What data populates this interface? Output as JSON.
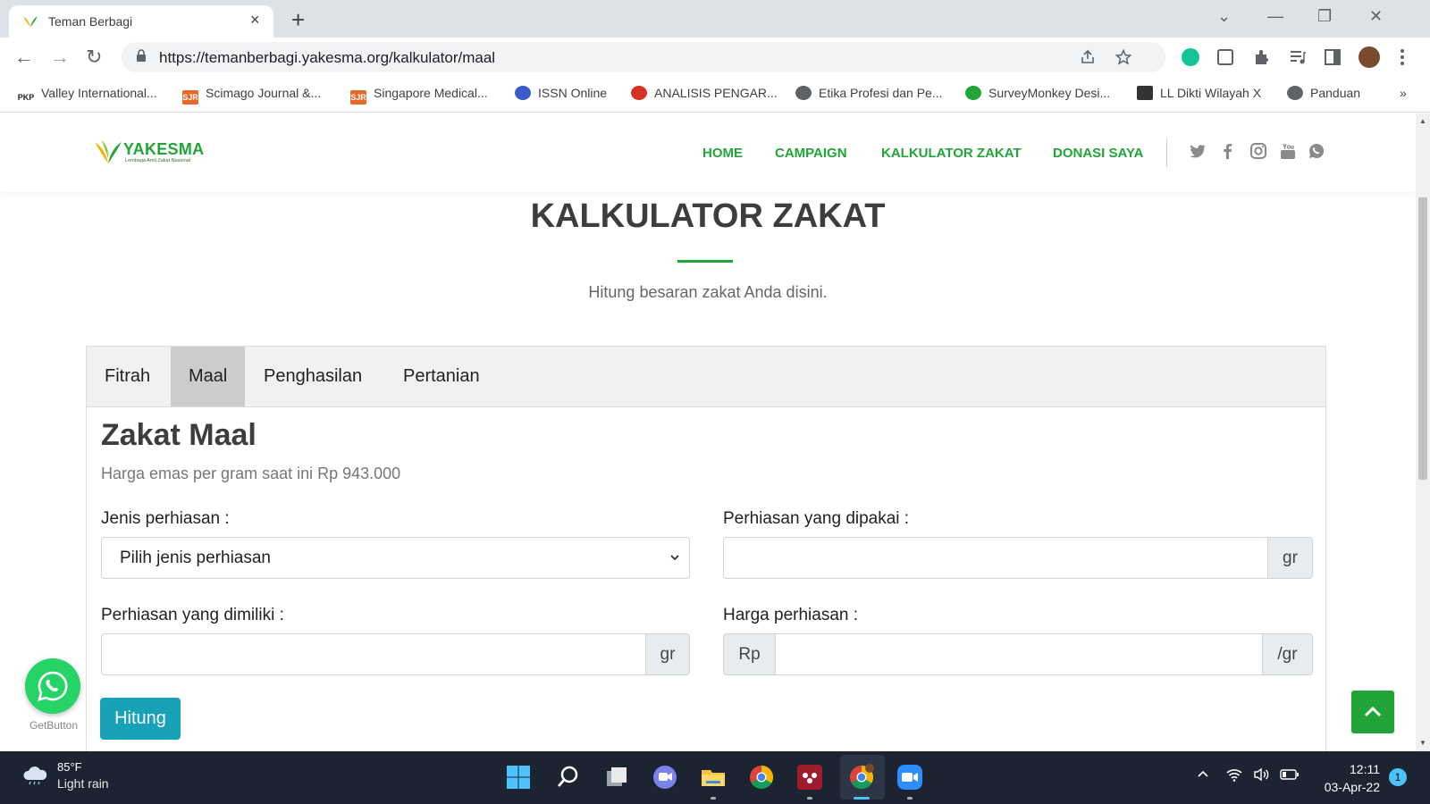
{
  "browser": {
    "tab_title": "Teman Berbagi",
    "tab_close": "×",
    "new_tab": "+",
    "url": "https://temanberbagi.yakesma.org/kalkulator/maal",
    "window_controls": {
      "dropdown": "⌄",
      "minimize": "—",
      "restore": "❐",
      "close": "✕"
    },
    "nav": {
      "back": "←",
      "forward": "→",
      "reload": "↻"
    },
    "bookmarks": [
      {
        "label": "Valley International...",
        "badge": "PKP",
        "color": "#ffffff"
      },
      {
        "label": "Scimago Journal &...",
        "badge": "SJR",
        "color": "#e8682a"
      },
      {
        "label": "Singapore Medical...",
        "badge": "SJR",
        "color": "#e8682a"
      },
      {
        "label": "ISSN Online",
        "badge": "",
        "color": "#3b5bcc"
      },
      {
        "label": "ANALISIS PENGAR...",
        "badge": "",
        "color": "#d93025"
      },
      {
        "label": "Etika Profesi dan Pe...",
        "badge": "",
        "color": "#5f6368"
      },
      {
        "label": "SurveyMonkey Desi...",
        "badge": "",
        "color": "#21a438"
      },
      {
        "label": "LL Dikti Wilayah X",
        "badge": "",
        "color": "#333333"
      },
      {
        "label": "Panduan",
        "badge": "",
        "color": "#5f6368"
      }
    ],
    "more_bookmarks": "»"
  },
  "site": {
    "logo_text": "YAKESMA",
    "logo_subtitle": "Lembaga Amil Zakat Nasional",
    "nav": [
      "HOME",
      "CAMPAIGN",
      "KALKULATOR ZAKAT",
      "DONASI SAYA"
    ],
    "social_icons": [
      "twitter-icon",
      "facebook-icon",
      "instagram-icon",
      "youtube-icon",
      "whatsapp-icon"
    ],
    "accent_color": "#21a438"
  },
  "page": {
    "title": "KALKULATOR ZAKAT",
    "subtitle": "Hitung besaran zakat Anda disini.",
    "tabs": [
      "Fitrah",
      "Maal",
      "Penghasilan",
      "Pertanian"
    ],
    "active_tab": "Maal",
    "section_title": "Zakat Maal",
    "gold_price": "Harga emas per gram saat ini Rp 943.000",
    "form": {
      "jenis_label": "Jenis perhiasan :",
      "jenis_value": "Pilih jenis perhiasan",
      "dipakai_label": "Perhiasan yang dipakai :",
      "dipakai_value": "",
      "dipakai_unit": "gr",
      "dimiliki_label": "Perhiasan yang dimiliki :",
      "dimiliki_value": "",
      "dimiliki_unit": "gr",
      "harga_label": "Harga perhiasan :",
      "harga_prefix": "Rp",
      "harga_value": "",
      "harga_unit": "/gr"
    },
    "submit_label": "Hitung",
    "getbutton_label": "GetButton"
  },
  "taskbar": {
    "temperature": "85°F",
    "weather": "Light rain",
    "time": "12:11",
    "date": "03-Apr-22",
    "notifications": "1"
  }
}
